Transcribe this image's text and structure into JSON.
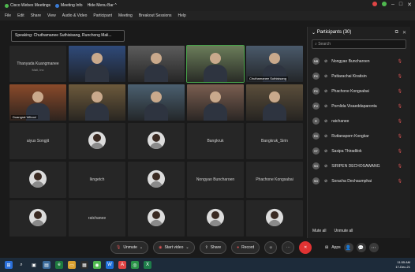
{
  "window": {
    "title": "Cisco Webex Meetings",
    "meeting_info": "Meeting Info",
    "hide_menu": "Hide Menu Bar ^"
  },
  "menu": [
    "File",
    "Edit",
    "Share",
    "View",
    "Audio & Video",
    "Participant",
    "Meeting",
    "Breakout Sessions",
    "Help"
  ],
  "speaking": "Speaking: Chuthamanee Suthisisang, Runchong Mali...",
  "tiles": [
    {
      "name": "Thanyada Kuangmanee",
      "sub": "Mali, Inc",
      "type": "text"
    },
    {
      "name": "",
      "type": "video"
    },
    {
      "name": "",
      "type": "video"
    },
    {
      "name": "",
      "type": "video",
      "active": true
    },
    {
      "name": "Chuthamanee Suthisisang",
      "type": "video"
    },
    {
      "name": "Duangrat Wibool",
      "type": "video"
    },
    {
      "name": "",
      "type": "video"
    },
    {
      "name": "",
      "type": "video"
    },
    {
      "name": "",
      "type": "video"
    },
    {
      "name": "",
      "type": "video"
    },
    {
      "name": "aiyus Songjit",
      "type": "text"
    },
    {
      "name": "",
      "type": "avatar"
    },
    {
      "name": "",
      "type": "avatar"
    },
    {
      "name": "Bangkruk",
      "type": "text"
    },
    {
      "name": "Bangkruk_Sirin",
      "type": "text"
    },
    {
      "name": "",
      "type": "avatar"
    },
    {
      "name": "Ikngetch",
      "type": "text"
    },
    {
      "name": "",
      "type": "avatar"
    },
    {
      "name": "Nongyao Buncharoen",
      "type": "text"
    },
    {
      "name": "Phachone Kongsabai",
      "type": "text"
    },
    {
      "name": "",
      "type": "avatar"
    },
    {
      "name": "ratchanee",
      "type": "text"
    },
    {
      "name": "",
      "type": "avatar"
    },
    {
      "name": "",
      "type": "avatar"
    },
    {
      "name": "",
      "type": "avatar"
    }
  ],
  "participants": {
    "header": "Participants (30)",
    "search_placeholder": "Search",
    "items": [
      {
        "name": "Nongyao Buncharoen",
        "initials": "NB"
      },
      {
        "name": "Pattarachai Kiratisin",
        "initials": "PK"
      },
      {
        "name": "Phachone Kongsabai",
        "initials": "PK"
      },
      {
        "name": "Pornlida Visaeddaparonta",
        "initials": "PV"
      },
      {
        "name": "ratchanee",
        "initials": "R"
      },
      {
        "name": "Ruttanaporn Kongkar",
        "initials": "RK"
      },
      {
        "name": "Sasipa Thiradilok",
        "initials": "ST"
      },
      {
        "name": "SIRIPEN DECHOSAWANG",
        "initials": "SD"
      },
      {
        "name": "Soracha Dechaumphai",
        "initials": "SD"
      }
    ],
    "mute_all": "Mute all",
    "unmute_all": "Unmute all"
  },
  "controls": {
    "unmute": "Unmute",
    "start_video": "Start video",
    "share": "Share",
    "record": "Record",
    "apps": "Apps"
  },
  "taskbar": {
    "time": "11:55 AM",
    "date": "17-Dec-21"
  }
}
